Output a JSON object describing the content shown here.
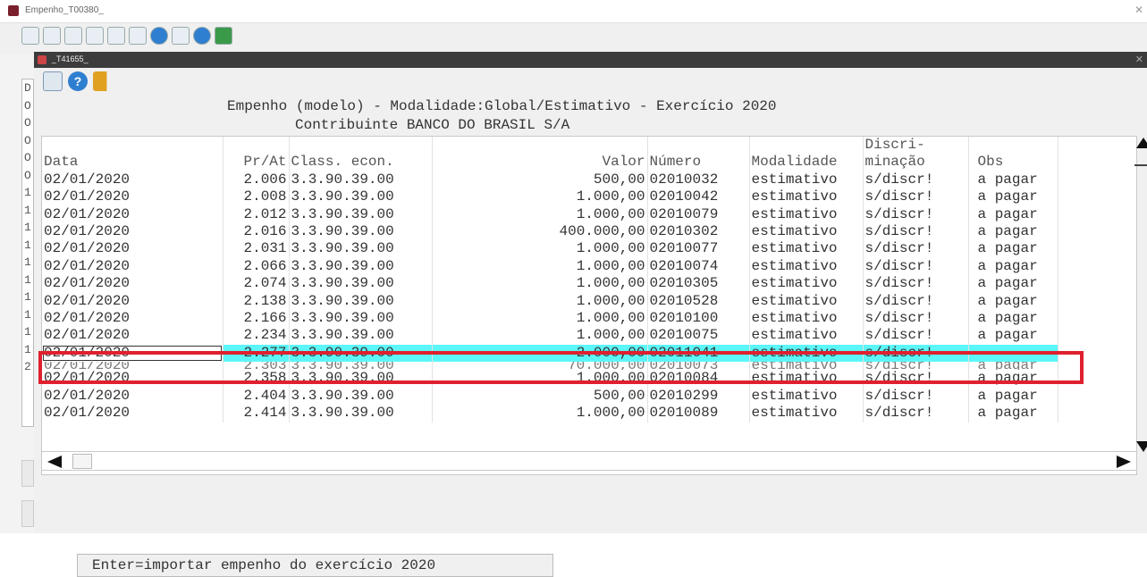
{
  "outer_window": {
    "title": "Empenho_T00380_"
  },
  "inner_window": {
    "title": "_T41655_"
  },
  "left_panel_letters": [
    "D",
    "O",
    "O",
    "O",
    "O",
    "O",
    "1",
    "1",
    "1",
    "1",
    "1",
    "1",
    "1",
    "1",
    "1",
    "1",
    "2"
  ],
  "header": {
    "line1": "Empenho (modelo) - Modalidade:Global/Estimativo - Exercício 2020",
    "line2": "Contribuinte BANCO DO BRASIL S/A"
  },
  "columns": {
    "data": "Data",
    "prat": "Pr/At",
    "class": "Class. econ.",
    "valor": "Valor",
    "numero": "Número",
    "modalidade": "Modalidade",
    "disc_top": "Discri-",
    "disc_bottom": "minação",
    "obs": "Obs"
  },
  "rows": [
    {
      "data": "02/01/2020",
      "prat": "2.006",
      "class": "3.3.90.39.00",
      "valor": "500,00",
      "numero": "02010032",
      "mod": "estimativo",
      "disc": "s/discr!",
      "obs": "a pagar"
    },
    {
      "data": "02/01/2020",
      "prat": "2.008",
      "class": "3.3.90.39.00",
      "valor": "1.000,00",
      "numero": "02010042",
      "mod": "estimativo",
      "disc": "s/discr!",
      "obs": "a pagar"
    },
    {
      "data": "02/01/2020",
      "prat": "2.012",
      "class": "3.3.90.39.00",
      "valor": "1.000,00",
      "numero": "02010079",
      "mod": "estimativo",
      "disc": "s/discr!",
      "obs": "a pagar"
    },
    {
      "data": "02/01/2020",
      "prat": "2.016",
      "class": "3.3.90.39.00",
      "valor": "400.000,00",
      "numero": "02010302",
      "mod": "estimativo",
      "disc": "s/discr!",
      "obs": "a pagar"
    },
    {
      "data": "02/01/2020",
      "prat": "2.031",
      "class": "3.3.90.39.00",
      "valor": "1.000,00",
      "numero": "02010077",
      "mod": "estimativo",
      "disc": "s/discr!",
      "obs": "a pagar"
    },
    {
      "data": "02/01/2020",
      "prat": "2.066",
      "class": "3.3.90.39.00",
      "valor": "1.000,00",
      "numero": "02010074",
      "mod": "estimativo",
      "disc": "s/discr!",
      "obs": "a pagar"
    },
    {
      "data": "02/01/2020",
      "prat": "2.074",
      "class": "3.3.90.39.00",
      "valor": "1.000,00",
      "numero": "02010305",
      "mod": "estimativo",
      "disc": "s/discr!",
      "obs": "a pagar"
    },
    {
      "data": "02/01/2020",
      "prat": "2.138",
      "class": "3.3.90.39.00",
      "valor": "1.000,00",
      "numero": "02010528",
      "mod": "estimativo",
      "disc": "s/discr!",
      "obs": "a pagar"
    },
    {
      "data": "02/01/2020",
      "prat": "2.166",
      "class": "3.3.90.39.00",
      "valor": "1.000,00",
      "numero": "02010100",
      "mod": "estimativo",
      "disc": "s/discr!",
      "obs": "a pagar"
    },
    {
      "data": "02/01/2020",
      "prat": "2.234",
      "class": "3.3.90.39.00",
      "valor": "1.000,00",
      "numero": "02010075",
      "mod": "estimativo",
      "disc": "s/discr!",
      "obs": "a pagar"
    },
    {
      "data": "02/01/2020",
      "prat": "2.277",
      "class": "3.3.90.39.00",
      "valor": "2.000,00",
      "numero": "02011041",
      "mod": "estimativo",
      "disc": "s/discr!",
      "obs": "",
      "selected": true
    },
    {
      "data": "02/01/2020",
      "prat": "2.303",
      "class": "3.3.90.39.00",
      "valor": "70.000,00",
      "numero": "02010073",
      "mod": "estimativo",
      "disc": "s/discr!",
      "obs": "a pagar",
      "clipped": true
    },
    {
      "data": "02/01/2020",
      "prat": "2.358",
      "class": "3.3.90.39.00",
      "valor": "1.000,00",
      "numero": "02010084",
      "mod": "estimativo",
      "disc": "s/discr!",
      "obs": "a pagar"
    },
    {
      "data": "02/01/2020",
      "prat": "2.404",
      "class": "3.3.90.39.00",
      "valor": "500,00",
      "numero": "02010299",
      "mod": "estimativo",
      "disc": "s/discr!",
      "obs": "a pagar"
    },
    {
      "data": "02/01/2020",
      "prat": "2.414",
      "class": "3.3.90.39.00",
      "valor": "1.000,00",
      "numero": "02010089",
      "mod": "estimativo",
      "disc": "s/discr!",
      "obs": "a pagar"
    }
  ],
  "status_text": "Enter=importar empenho do exercício 2020",
  "colors": {
    "selection": "#5cf6f8",
    "highlight_border": "#e0202e"
  }
}
